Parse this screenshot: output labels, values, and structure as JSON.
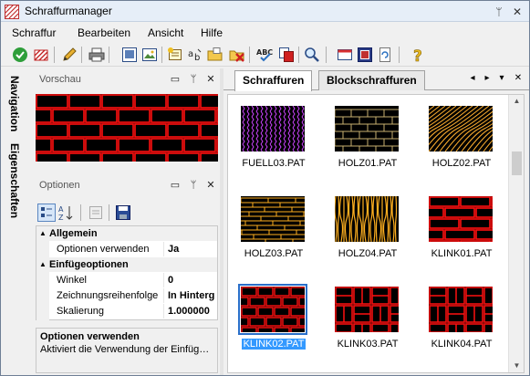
{
  "window": {
    "title": "Schraffurmanager",
    "controls": {
      "pin": "ᛘ",
      "close": "✕"
    }
  },
  "menu": [
    "Schraffur",
    "Bearbeiten",
    "Ansicht",
    "Hilfe"
  ],
  "toolbar": {
    "icons": [
      "check-icon",
      "hatch-delete-icon",
      "pencil-icon",
      "print-icon",
      "preview-window-icon",
      "image-icon",
      "new-hatch-icon",
      "text-replace-icon",
      "folder-open-icon",
      "folder-delete-icon",
      "spellcheck-icon",
      "copy-icon",
      "magnify-icon",
      "panel-icon",
      "frame-icon",
      "refresh-icon",
      "help-icon"
    ]
  },
  "side_tabs": [
    "Navigation",
    "Eigenschaften"
  ],
  "preview_panel": {
    "title": "Vorschau",
    "pattern_color": "#ff1010"
  },
  "options_panel": {
    "title": "Optionen",
    "categories": [
      {
        "name": "Allgemein",
        "rows": [
          {
            "name": "Optionen verwenden",
            "value": "Ja"
          }
        ]
      },
      {
        "name": "Einfügeoptionen",
        "rows": [
          {
            "name": "Winkel",
            "value": "0"
          },
          {
            "name": "Zeichnungsreihenfolge",
            "value": "In Hinterg"
          },
          {
            "name": "Skalierung",
            "value": "1.000000"
          }
        ]
      }
    ],
    "description": {
      "title": "Optionen verwenden",
      "text": "Aktiviert die Verwendung der Einfüg…"
    }
  },
  "tabs": [
    {
      "label": "Schraffuren",
      "active": true
    },
    {
      "label": "Blockschraffuren",
      "active": false
    }
  ],
  "tab_controls": {
    "prev": "◂",
    "next": "▸",
    "menu": "▾",
    "close": "✕"
  },
  "hatches": [
    {
      "label": "FUELL03.PAT",
      "pattern": "fuell03",
      "color": "#cc44ff",
      "selected": false
    },
    {
      "label": "HOLZ01.PAT",
      "pattern": "holz01",
      "color": "#c8b070",
      "selected": false
    },
    {
      "label": "HOLZ02.PAT",
      "pattern": "holz02",
      "color": "#ffb030",
      "selected": false
    },
    {
      "label": "HOLZ03.PAT",
      "pattern": "holz03",
      "color": "#ffb020",
      "selected": false
    },
    {
      "label": "HOLZ04.PAT",
      "pattern": "holz04",
      "color": "#ffb020",
      "selected": false
    },
    {
      "label": "KLINK01.PAT",
      "pattern": "klink01",
      "color": "#ff1010",
      "selected": false
    },
    {
      "label": "KLINK02.PAT",
      "pattern": "klink02",
      "color": "#ff1010",
      "selected": true
    },
    {
      "label": "KLINK03.PAT",
      "pattern": "klink03",
      "color": "#ff1010",
      "selected": false
    },
    {
      "label": "KLINK04.PAT",
      "pattern": "klink04",
      "color": "#ff1010",
      "selected": false
    }
  ]
}
